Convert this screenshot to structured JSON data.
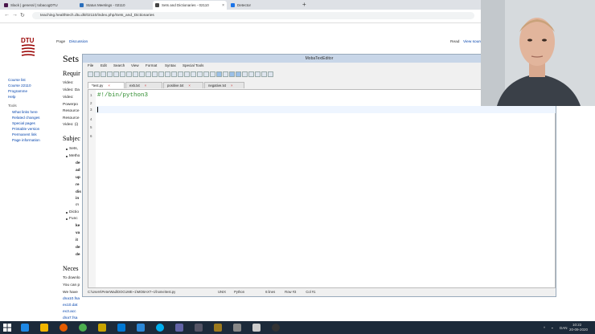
{
  "browser": {
    "tabs": [
      {
        "label": "Slack | general | tobacogDTU",
        "color": "#4a154b",
        "active": false
      },
      {
        "label": "Status Meetings - 02110",
        "color": "#2a6ebb",
        "active": false
      },
      {
        "label": "Sets and Dictionaries - 02110",
        "color": "#444",
        "active": true
      },
      {
        "label": "Detector",
        "color": "#1a73e8",
        "active": false
      }
    ],
    "new_tab": "+",
    "url": "teaching.healthtech.dtu.dk/02110/index.php/Sets_and_Dictionaries"
  },
  "wiki": {
    "logo": "DTU",
    "nav_tabs": [
      "Page",
      "Discussion"
    ],
    "right_tabs": [
      "Read",
      "View source"
    ],
    "sidebar": [
      "Course list",
      "Course 22110",
      "Programme",
      "Help"
    ],
    "tools_header": "Tools",
    "tools": [
      "What links here",
      "Related changes",
      "Special pages",
      "Printable version",
      "Permanent link",
      "Page information"
    ],
    "title": "Sets",
    "req_heading": "Requir",
    "req_lines": [
      "Video: ",
      "Video: Da",
      "Video: ",
      "Powerpo",
      "Resource",
      "Resource",
      "Video: (i)"
    ],
    "subj_heading": "Subjec",
    "subj_lines": [
      "Sets, ",
      "Metho",
      "de",
      "ad",
      "up",
      "re",
      "dis",
      "in",
      "m",
      "Dictio",
      "Func",
      "ke",
      "va",
      "it",
      "de",
      "de"
    ],
    "nec_heading": "Neces",
    "nec_lines": [
      "To downlo",
      "You can p",
      "We have",
      "dna10.fsa",
      "ex10.dat",
      "ex3.acc",
      "dna7.fsa"
    ]
  },
  "editor": {
    "title": "MobaTextEditor",
    "menu": [
      "File",
      "Edit",
      "Search",
      "View",
      "Format",
      "Syntax",
      "Special Tools"
    ],
    "tabs": [
      {
        "label": "*test.py",
        "active": true
      },
      {
        "label": "ex5.txt",
        "active": false
      },
      {
        "label": "positive.txt",
        "active": false
      },
      {
        "label": "negative.txt",
        "active": false
      }
    ],
    "line_numbers": [
      "1",
      "2",
      "3",
      "4",
      "5",
      "6"
    ],
    "code": [
      "#!/bin/python3"
    ],
    "status": [
      "C:\\Users\\PeterWad\\DOCUME~1\\MOBAXT~1\\home\\test.py",
      "UNIX",
      "Python",
      "6 lines",
      "Row #3",
      "Col #1"
    ]
  },
  "taskbar": {
    "time": "10:22",
    "date": "20-09-2020",
    "lang": "DAN"
  }
}
